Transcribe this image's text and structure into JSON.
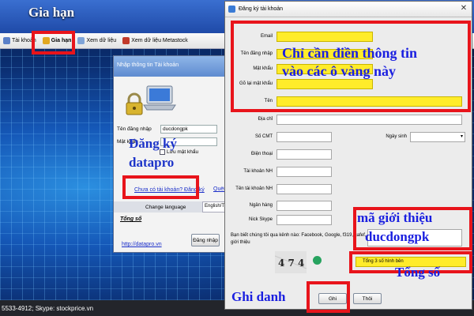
{
  "annotations": {
    "gia_han_label": "Gia hạn",
    "fill_yellow_line1": "Chỉ cần điền thông tin",
    "fill_yellow_line2": "vào các ô vàng này",
    "dang_ky_line1": "Đăng ký",
    "dang_ky_line2": "datapro",
    "referral_line1": "mã giới thiệu",
    "referral_line2": "ducdongpk",
    "tong_so": "Tổng số",
    "ghi_danh": "Ghi danh"
  },
  "menu": {
    "items": [
      {
        "label": "Tài khoản",
        "icon": "user-icon"
      },
      {
        "label": "Gia hạn",
        "icon": "renew-icon"
      },
      {
        "label": "Xem dữ liệu",
        "icon": "data-icon"
      },
      {
        "label": "Xem dữ liệu Metastock",
        "icon": "metastock-icon"
      }
    ]
  },
  "status_bar": {
    "text": "5533-4912; Skype: stockprice.vn"
  },
  "login": {
    "title": "Nhập thông tin Tài khoản",
    "username_label": "Tên đăng nhập",
    "username_value": "ducdongpk",
    "password_label": "Mật khẩu",
    "password_value": "",
    "remember_label": "Lưu mật khẩu",
    "no_account_link": "Chưa có tài khoản? Đăng ký",
    "forgot_link": "Quên mật",
    "change_language": "Change language",
    "language_tab": "English/Tiếng",
    "tong_so": "Tổng số",
    "website": "http://datapro.vn",
    "login_button": "Đăng nhập"
  },
  "register": {
    "title": "Đăng ký tài khoản",
    "fields": {
      "email": "Email",
      "username": "Tên đăng nhập",
      "password": "Mật khẩu",
      "password_confirm": "Gõ lại mật khẩu",
      "name": "Tên",
      "address": "Địa chỉ",
      "id_card": "Số CMT",
      "birthday": "Ngày sinh",
      "phone": "Điện thoại",
      "bank_account": "Tài khoản NH",
      "bank_account_name": "Tên tài khoản NH",
      "bank": "Ngân hàng",
      "skype": "Nick Skype"
    },
    "survey": "Bạn biết chúng tôi qua kênh nào: Facebook, Google, f319, cafef, người giới thiệu",
    "referral_value": "",
    "captcha_text": "4 7 4",
    "captcha_sum_label": "Tổng 3 số hình bên",
    "captcha_sum_value": "",
    "submit_button": "Ghi",
    "cancel_button": "Thôi",
    "close_symbol": "✕"
  },
  "colors": {
    "highlight_red": "#e8141b",
    "required_yellow": "#ffec2a",
    "annotation_blue": "#1d34c9"
  }
}
